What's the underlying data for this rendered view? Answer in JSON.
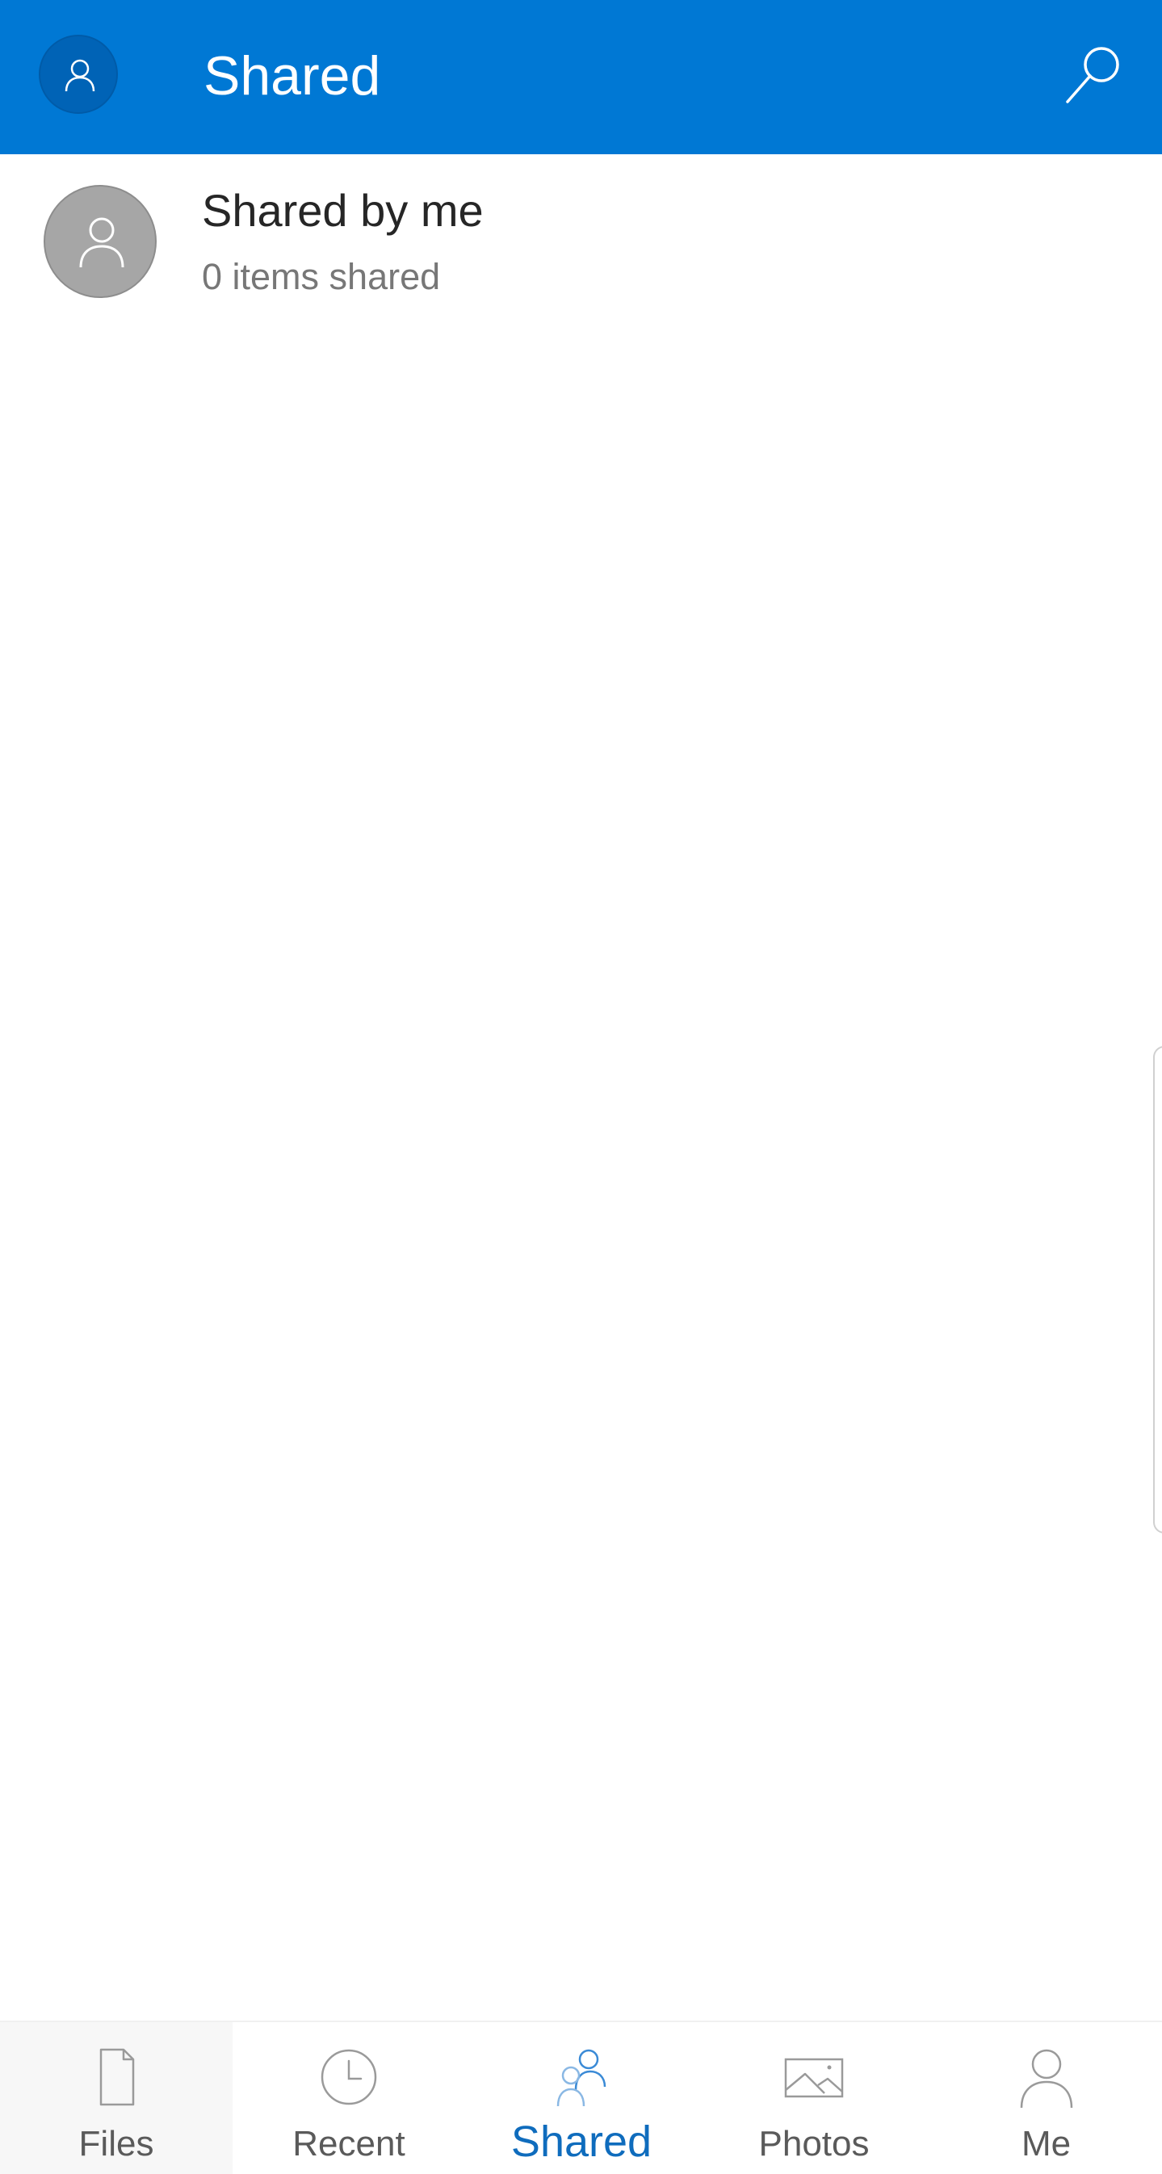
{
  "header": {
    "title": "Shared",
    "account_icon": "person-icon",
    "search_icon": "search-icon",
    "background_color": "#0078d4"
  },
  "rows": [
    {
      "title": "Shared by me",
      "subtitle": "0 items shared",
      "icon": "person-icon"
    }
  ],
  "bottom_nav": {
    "active_index": 2,
    "active_color": "#0f6cbd",
    "items": [
      {
        "label": "Files",
        "icon": "file-icon"
      },
      {
        "label": "Recent",
        "icon": "clock-icon"
      },
      {
        "label": "Shared",
        "icon": "people-icon"
      },
      {
        "label": "Photos",
        "icon": "image-icon"
      },
      {
        "label": "Me",
        "icon": "person-icon"
      }
    ]
  }
}
